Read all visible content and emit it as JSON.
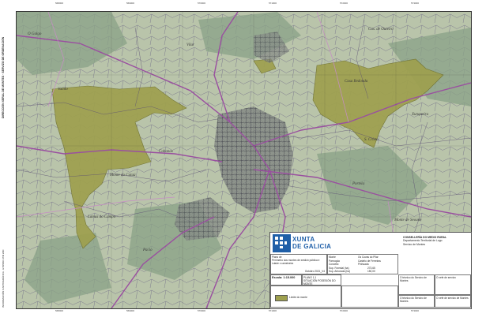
{
  "map": {
    "colors": {
      "terrain": "#b9c4aa",
      "terrain_dark": "#7f9b7c",
      "forest_highlight": "#9ea04e",
      "roads": "#9a4fa0",
      "parcel_lines": "#5b4f73",
      "urban": "#3c3c4a"
    },
    "place_names": [
      "O Galgo",
      "Casa Redonda",
      "S. Cristo",
      "Monte do Cataú",
      "Valiño",
      "Cabanas",
      "Cas. de Outeiro",
      "Portela",
      "Lamas do Campo",
      "Monte de Seoane",
      "Pacio",
      "Xunqueira",
      "Vilar"
    ]
  },
  "brand": {
    "name_line1": "XUNTA",
    "name_line2": "DE GALICIA",
    "ministry": "CONSELLERÍA DO MEDIO RURAL",
    "department": "Departamento Territorial de Lugo",
    "service": "Servizo de Montes",
    "logo_color": "#1f5fa8"
  },
  "titleblock": {
    "plan_label": "Plano de",
    "plan_desc": "Perímetro dos montes de xestión pública e Ldade: a ameixeira",
    "date_label": "Outubro 2021_V4",
    "scale": "Escala: 1:15.000",
    "plan_no": "PLANO 1.1",
    "plan_title": "SITUACIÓN POSESIÓN DO MONTE",
    "field_labels": [
      "Monte",
      "Parroquia",
      "Concello",
      "Sup. Forestal (ha)",
      "Sup. Arborada (ha)"
    ],
    "field_values": [
      "Os Covas do Pilar",
      "Castelo de Ferreiras",
      "Pinhuada",
      "273,65",
      "150,00"
    ],
    "signature_left": "O técnico do Servizo de Montes",
    "signature_right": "O xefe de servizo",
    "footer_left": "O técnico do Servizo de Montes",
    "footer_mid": "O xefe de servizo de Montes",
    "legend_label": "Límite do monte"
  }
}
